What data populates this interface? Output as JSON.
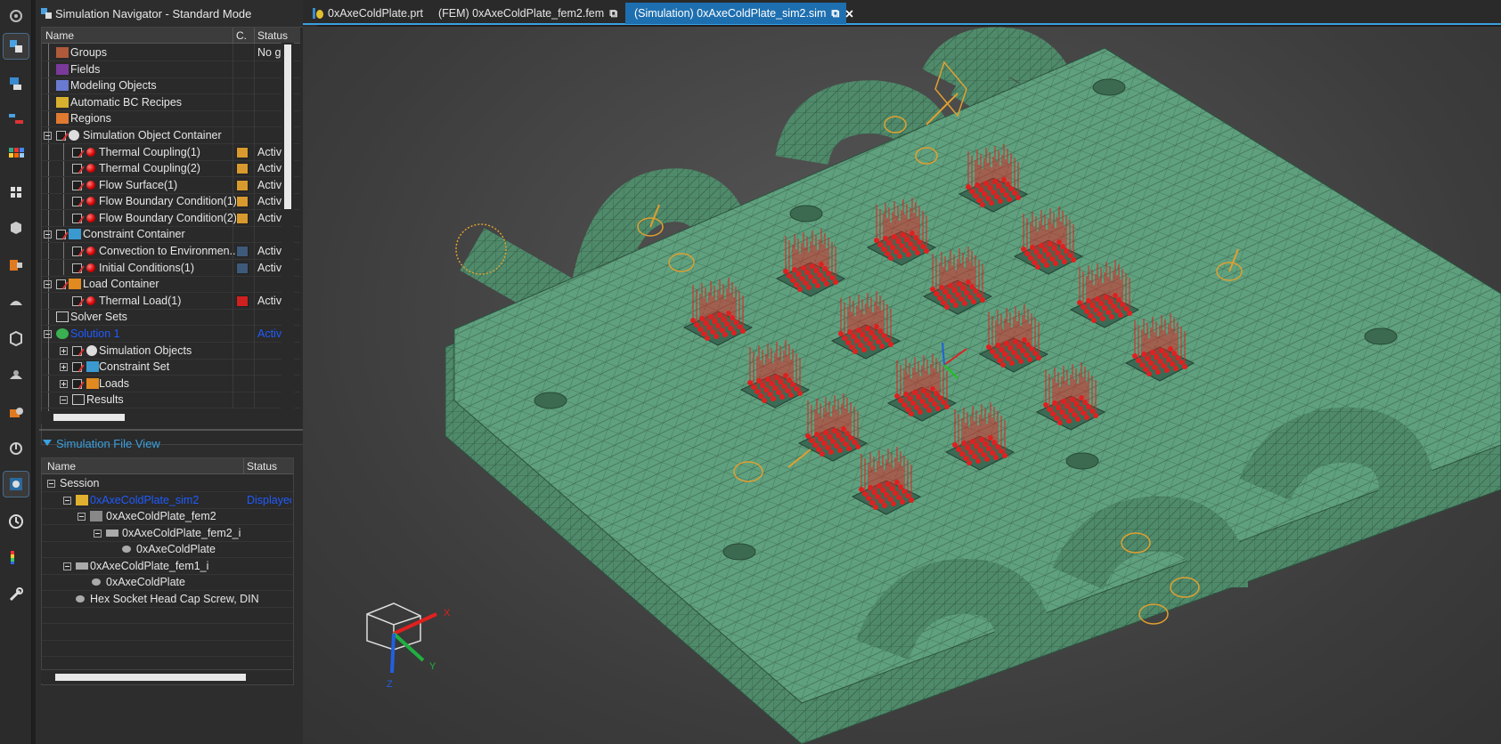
{
  "navigator": {
    "title": "Simulation Navigator - Standard Mode",
    "columns": [
      "Name",
      "C.",
      "Status"
    ],
    "rows": [
      {
        "label": "Groups",
        "status": "No gro"
      },
      {
        "label": "Fields",
        "status": ""
      },
      {
        "label": "Modeling Objects",
        "status": ""
      },
      {
        "label": "Automatic BC Recipes",
        "status": ""
      },
      {
        "label": "Regions",
        "status": ""
      },
      {
        "label": "Simulation Object Container",
        "status": ""
      },
      {
        "label": "Thermal Coupling(1)",
        "status": "Active"
      },
      {
        "label": "Thermal Coupling(2)",
        "status": "Active"
      },
      {
        "label": "Flow Surface(1)",
        "status": "Active"
      },
      {
        "label": "Flow Boundary Condition(1)",
        "status": "Active"
      },
      {
        "label": "Flow Boundary Condition(2)",
        "status": "Active"
      },
      {
        "label": "Constraint Container",
        "status": ""
      },
      {
        "label": "Convection to Environmen...",
        "status": "Active"
      },
      {
        "label": "Initial Conditions(1)",
        "status": "Active"
      },
      {
        "label": "Load Container",
        "status": ""
      },
      {
        "label": "Thermal Load(1)",
        "status": "Active"
      },
      {
        "label": "Solver Sets",
        "status": ""
      },
      {
        "label": "Solution 1",
        "status": "Active"
      },
      {
        "label": "Simulation Objects",
        "status": ""
      },
      {
        "label": "Constraint Set",
        "status": ""
      },
      {
        "label": "Loads",
        "status": ""
      },
      {
        "label": "Results",
        "status": ""
      }
    ]
  },
  "file_view": {
    "title": "Simulation File View",
    "columns": [
      "Name",
      "Status"
    ],
    "rows": [
      {
        "label": "Session",
        "status": ""
      },
      {
        "label": "0xAxeColdPlate_sim2",
        "status": "Displayed"
      },
      {
        "label": "0xAxeColdPlate_fem2",
        "status": ""
      },
      {
        "label": "0xAxeColdPlate_fem2_i",
        "status": ""
      },
      {
        "label": "0xAxeColdPlate",
        "status": ""
      },
      {
        "label": "0xAxeColdPlate_fem1_i",
        "status": ""
      },
      {
        "label": "0xAxeColdPlate",
        "status": ""
      },
      {
        "label": "Hex Socket Head Cap Screw, DIN",
        "status": ""
      }
    ]
  },
  "tabs": [
    {
      "label": "0xAxeColdPlate.prt"
    },
    {
      "label": "(FEM) 0xAxeColdPlate_fem2.fem"
    },
    {
      "label": "(Simulation) 0xAxeColdPlate_sim2.sim"
    }
  ],
  "triad": {
    "x": "X",
    "y": "Y",
    "z": "Z"
  },
  "colors": {
    "accent": "#3aa0e0",
    "mesh_fill": "#5fa07e",
    "load_arrow": "#e02020",
    "constraint": "#e0a030",
    "swatch_orange": "#d89a2e",
    "swatch_blue": "#3e5a7a",
    "swatch_red": "#d02020"
  }
}
